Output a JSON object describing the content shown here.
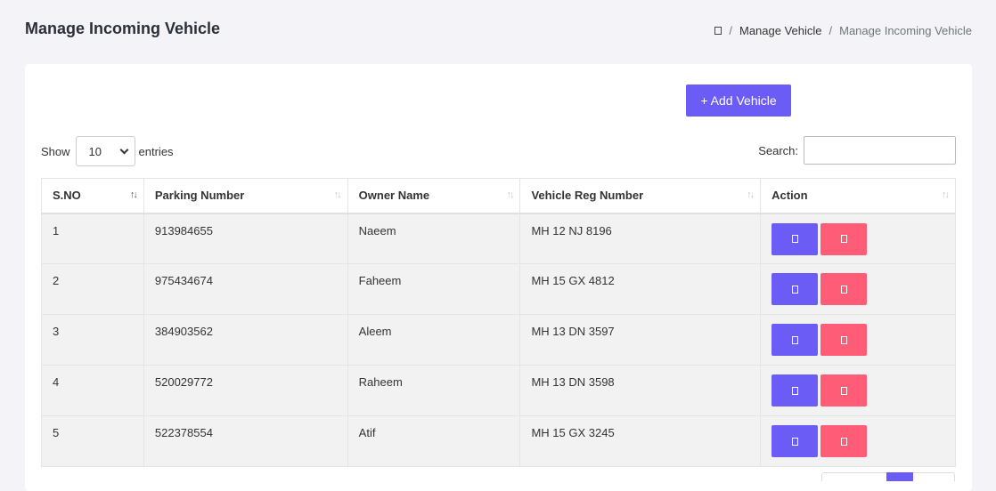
{
  "page": {
    "title": "Manage Incoming Vehicle"
  },
  "breadcrumb": {
    "home_icon": "home-icon",
    "items": [
      "Manage Vehicle",
      "Manage Incoming Vehicle"
    ],
    "separator": "/"
  },
  "toolbar": {
    "add_label": "+ Add Vehicle",
    "accent": "#6c5cf6"
  },
  "length": {
    "show_label": "Show",
    "selected": "10",
    "entries_label": "entries"
  },
  "search": {
    "label": "Search:",
    "value": "",
    "placeholder": ""
  },
  "table": {
    "headers": [
      "S.NO",
      "Parking Number",
      "Owner Name",
      "Vehicle Reg Number",
      "Action"
    ],
    "rows": [
      {
        "sno": "1",
        "parking": "913984655",
        "owner": "Naeem",
        "reg": "MH 12 NJ 8196"
      },
      {
        "sno": "2",
        "parking": "975434674",
        "owner": "Faheem",
        "reg": "MH 15 GX 4812"
      },
      {
        "sno": "3",
        "parking": "384903562",
        "owner": "Aleem",
        "reg": "MH 13 DN 3597"
      },
      {
        "sno": "4",
        "parking": "520029772",
        "owner": "Raheem",
        "reg": "MH 13 DN 3598"
      },
      {
        "sno": "5",
        "parking": "522378554",
        "owner": "Atif",
        "reg": "MH 15 GX 3245"
      }
    ],
    "edit_icon": "edit-icon",
    "delete_icon": "delete-icon",
    "edit_color": "#6c5cf6",
    "delete_color": "#ff5c77"
  }
}
